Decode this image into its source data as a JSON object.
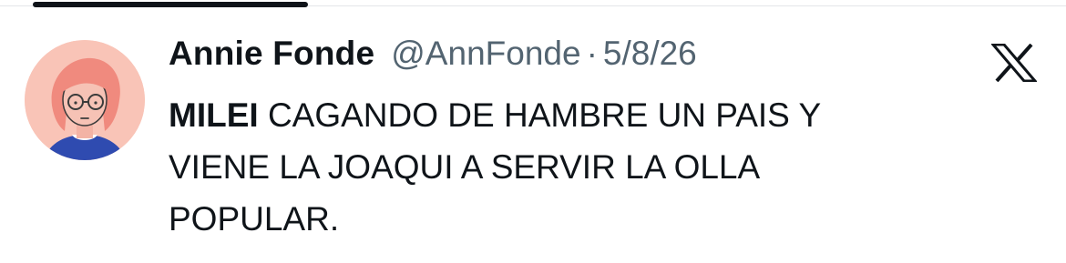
{
  "tweet": {
    "author": {
      "display_name": "Annie Fonde",
      "handle": "@AnnFonde",
      "avatar_icon": "illustrated-avatar-pink-hair-glasses"
    },
    "separator": "·",
    "date": "5/8/26",
    "text": {
      "bold_word": "MILEI",
      "line1_rest": " CAGANDO DE HAMBRE UN PAIS Y",
      "line2": "VIENE LA JOAQUI A SERVIR LA OLLA",
      "line3": "POPULAR."
    },
    "platform_icon": "x-logo-icon"
  },
  "colors": {
    "text_primary": "#0f1419",
    "text_secondary": "#536471",
    "avatar_bg": "#f9c4b7",
    "avatar_hair": "#f08a7e",
    "avatar_shirt": "#2f4bb0",
    "background": "#ffffff"
  }
}
